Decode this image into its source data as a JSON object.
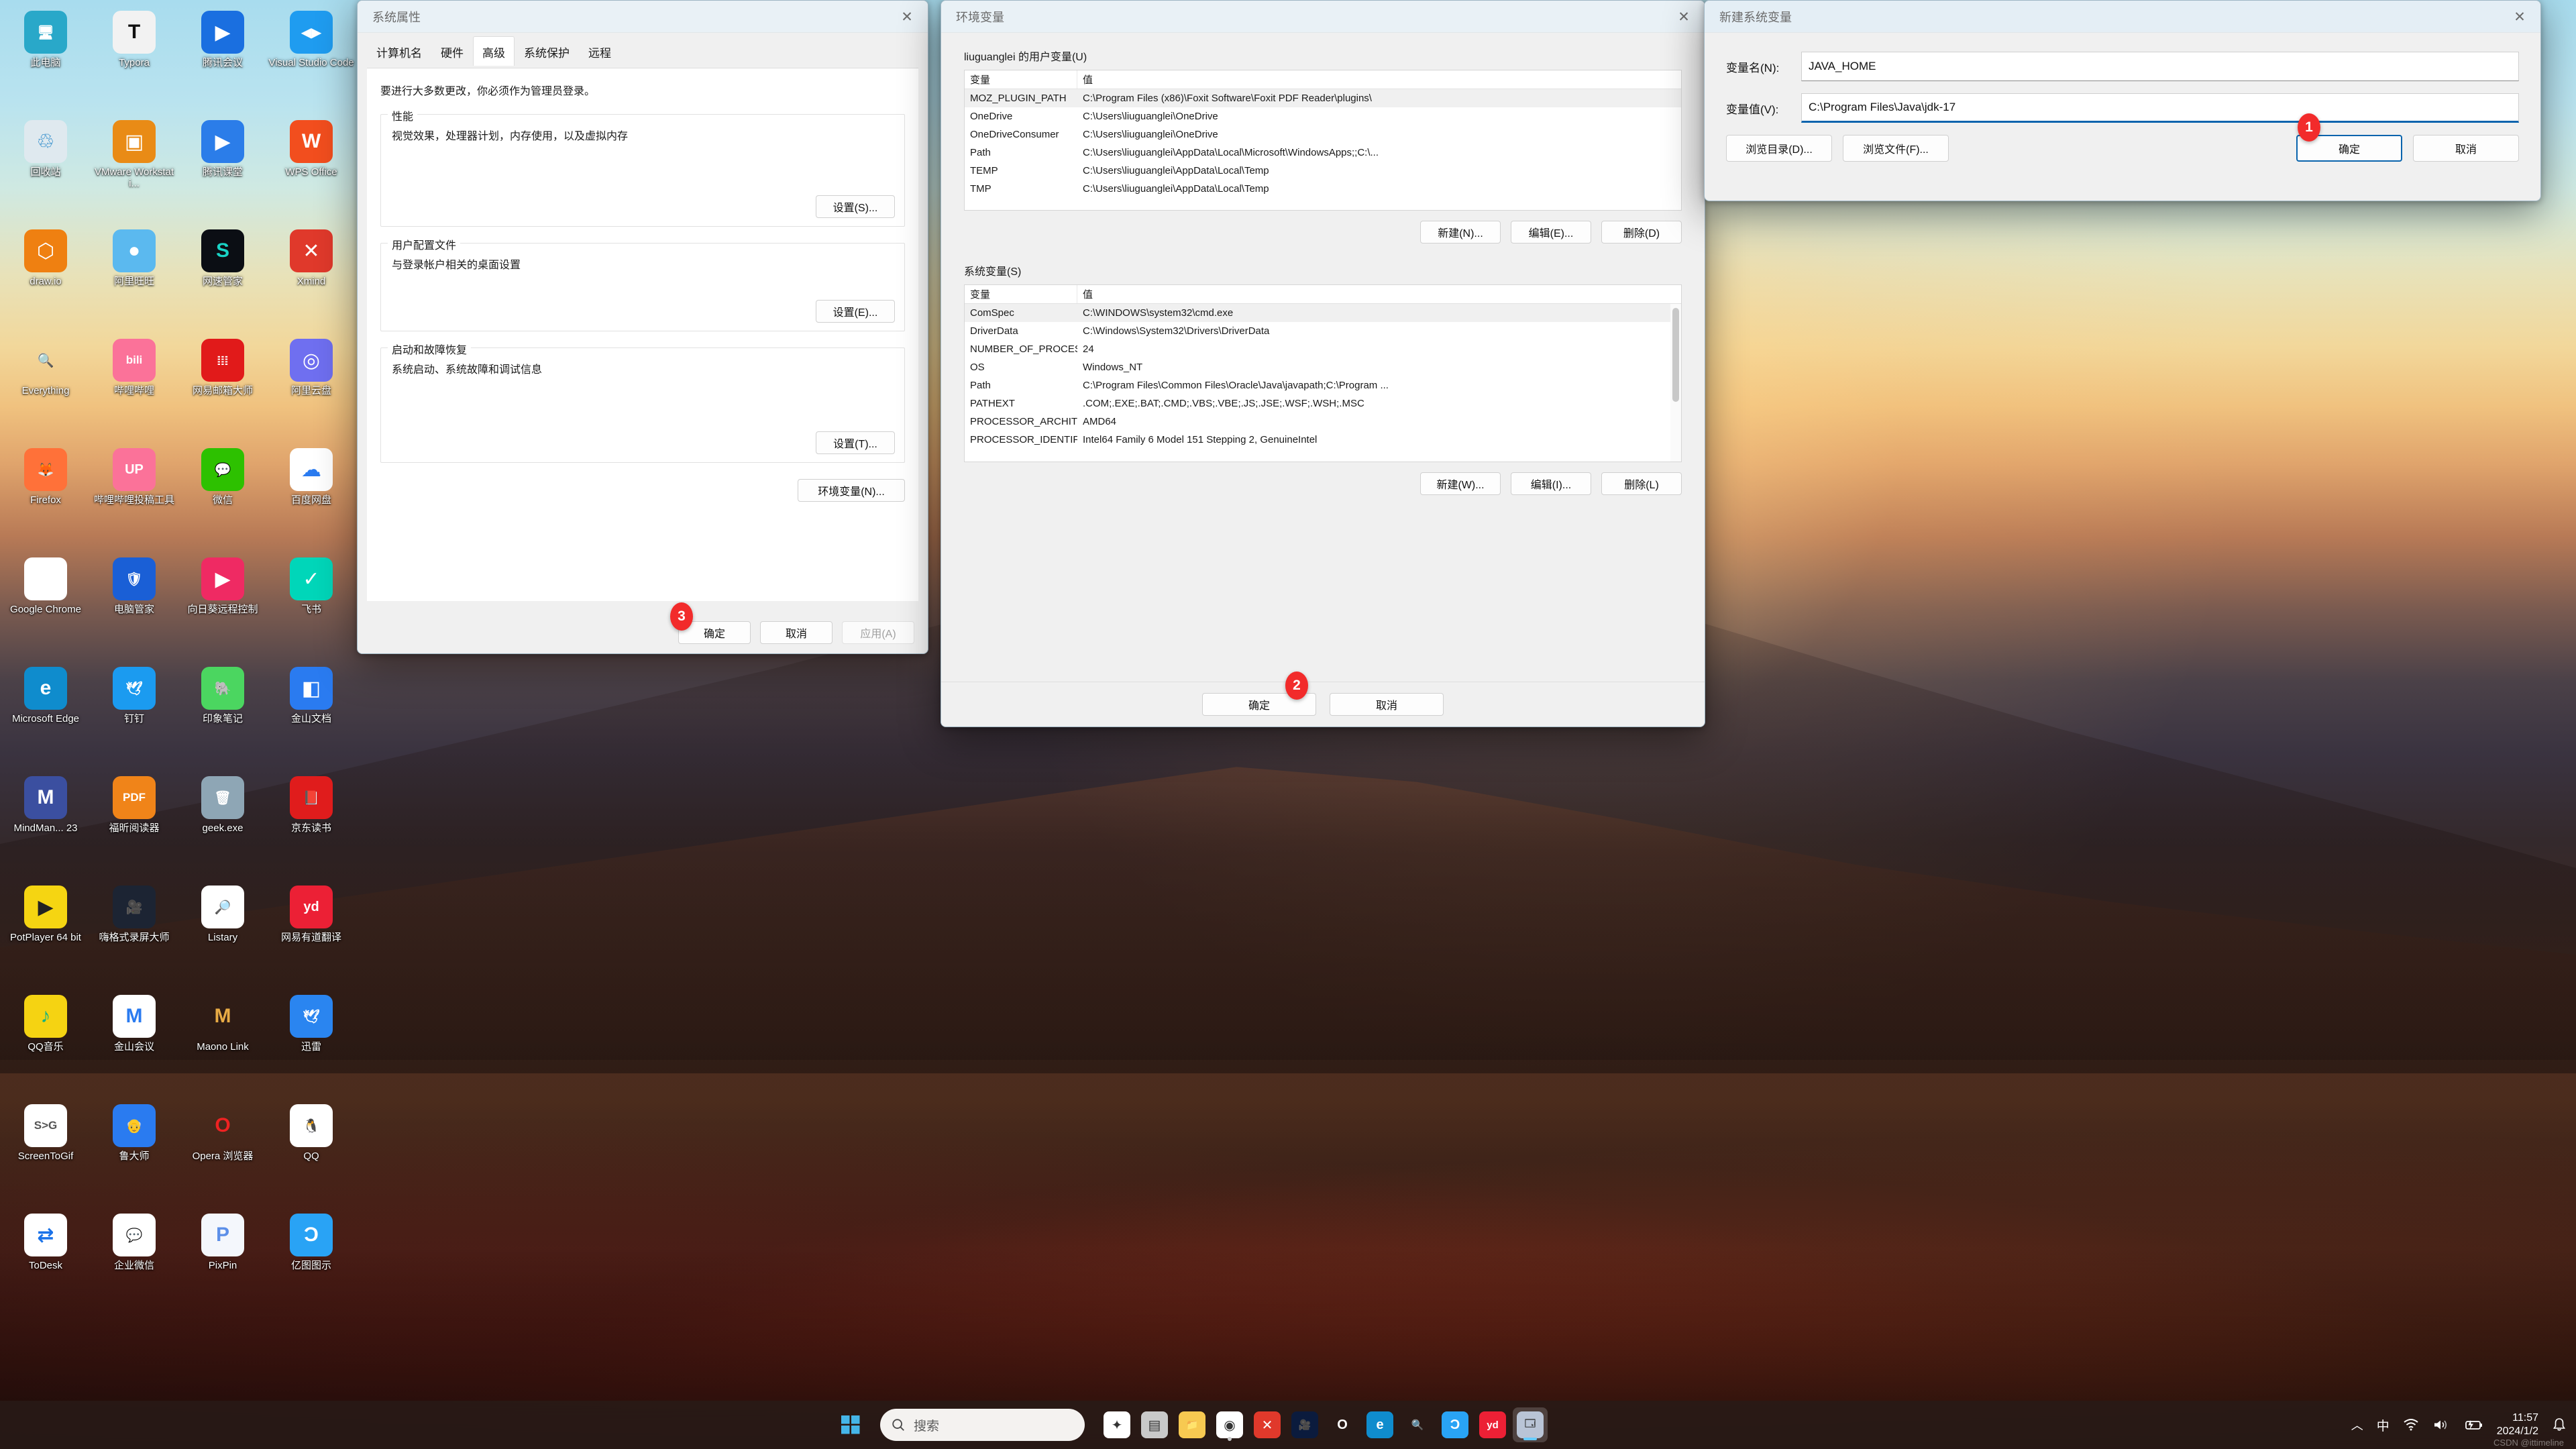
{
  "desktop": {
    "icons": [
      {
        "label": "此电脑",
        "icon": "this-pc-icon",
        "color": "#29a8c9",
        "glyph": "🖥"
      },
      {
        "label": "Typora",
        "icon": "typora-icon",
        "color": "#f2f2f2",
        "glyph": "T",
        "fg": "#111"
      },
      {
        "label": "腾讯会议",
        "icon": "tencent-meeting-icon",
        "color": "#1a6fe0",
        "glyph": "▶"
      },
      {
        "label": "Visual Studio Code",
        "icon": "vscode-icon",
        "color": "#1f9cf0",
        "glyph": "◀▶"
      },
      {
        "label": "回收站",
        "icon": "recycle-bin-icon",
        "color": "#dfe9ef",
        "glyph": "♲",
        "fg": "#1f84c8"
      },
      {
        "label": "VMware Workstati...",
        "icon": "vmware-icon",
        "color": "#e98b16",
        "glyph": "▣"
      },
      {
        "label": "腾讯课堂",
        "icon": "tencent-classroom-icon",
        "color": "#2b7de9",
        "glyph": "▶"
      },
      {
        "label": "WPS Office",
        "icon": "wps-office-icon",
        "color": "#f24e1e",
        "glyph": "W"
      },
      {
        "label": "draw.io",
        "icon": "drawio-icon",
        "color": "#ef8011",
        "glyph": "⬡"
      },
      {
        "label": "阿里旺旺",
        "icon": "aliwangwang-icon",
        "color": "#5bb9ef",
        "glyph": "●"
      },
      {
        "label": "网速管家",
        "icon": "netspeed-icon",
        "color": "#0b0e14",
        "glyph": "S",
        "fg": "#19d3c5"
      },
      {
        "label": "Xmind",
        "icon": "xmind-icon",
        "color": "#e0392b",
        "glyph": "✕"
      },
      {
        "label": "Everything",
        "icon": "everything-icon",
        "color": "#00000000",
        "glyph": "🔍",
        "fg": "#ef7f11"
      },
      {
        "label": "哔哩哔哩",
        "icon": "bilibili-icon",
        "color": "#fb7299",
        "glyph": "bili"
      },
      {
        "label": "网易邮箱大师",
        "icon": "netease-mail-icon",
        "color": "#e11a1a",
        "glyph": "𝍖"
      },
      {
        "label": "阿里云盘",
        "icon": "aliyun-drive-icon",
        "color": "#6f6ff0",
        "glyph": "◎"
      },
      {
        "label": "Firefox",
        "icon": "firefox-icon",
        "color": "#ff7139",
        "glyph": "🦊"
      },
      {
        "label": "哔哩哔哩投稿工具",
        "icon": "bilibili-upload-icon",
        "color": "#fb7299",
        "glyph": "UP"
      },
      {
        "label": "微信",
        "icon": "wechat-icon",
        "color": "#2dc100",
        "glyph": "💬"
      },
      {
        "label": "百度网盘",
        "icon": "baidu-netdisk-icon",
        "color": "#ffffff",
        "glyph": "☁",
        "fg": "#2a7bf0"
      },
      {
        "label": "Google Chrome",
        "icon": "chrome-icon",
        "color": "#ffffff",
        "glyph": "◉"
      },
      {
        "label": "电脑管家",
        "icon": "pc-manager-icon",
        "color": "#1a5fd6",
        "glyph": "🛡"
      },
      {
        "label": "向日葵远程控制",
        "icon": "sunlogin-icon",
        "color": "#ef2a63",
        "glyph": "▶"
      },
      {
        "label": "飞书",
        "icon": "feishu-icon",
        "color": "#00d6b9",
        "glyph": "✓"
      },
      {
        "label": "Microsoft Edge",
        "icon": "edge-icon",
        "color": "#0f8ccd",
        "glyph": "e"
      },
      {
        "label": "钉钉",
        "icon": "dingtalk-icon",
        "color": "#1b9bf0",
        "glyph": "🕊"
      },
      {
        "label": "印象笔记",
        "icon": "evernote-icon",
        "color": "#4bd660",
        "glyph": "🐘"
      },
      {
        "label": "金山文档",
        "icon": "kingsoft-docs-icon",
        "color": "#2a7bf0",
        "glyph": "◧"
      },
      {
        "label": "MindMan... 23",
        "icon": "mindmanager-icon",
        "color": "#3b4fa0",
        "glyph": "M"
      },
      {
        "label": "福昕阅读器",
        "icon": "foxit-reader-icon",
        "color": "#f08419",
        "glyph": "PDF"
      },
      {
        "label": "geek.exe",
        "icon": "geek-uninstaller-icon",
        "color": "#8ea6b5",
        "glyph": "🗑"
      },
      {
        "label": "京东读书",
        "icon": "jd-read-icon",
        "color": "#e01c1c",
        "glyph": "📕"
      },
      {
        "label": "PotPlayer 64 bit",
        "icon": "potplayer-icon",
        "color": "#f5d512",
        "glyph": "▶",
        "fg": "#222"
      },
      {
        "label": "嗨格式录屏大师",
        "icon": "higeshi-recorder-icon",
        "color": "#1c2433",
        "glyph": "🎥"
      },
      {
        "label": "Listary",
        "icon": "listary-icon",
        "color": "#ffffff",
        "glyph": "🔎"
      },
      {
        "label": "网易有道翻译",
        "icon": "youdao-translate-icon",
        "color": "#ec2035",
        "glyph": "yd"
      },
      {
        "label": "QQ音乐",
        "icon": "qq-music-icon",
        "color": "#f5d312",
        "glyph": "♪",
        "fg": "#16b37f"
      },
      {
        "label": "金山会议",
        "icon": "kingsoft-meeting-icon",
        "color": "#ffffff",
        "glyph": "M",
        "fg": "#2a7bf0"
      },
      {
        "label": "Maono Link",
        "icon": "maono-link-icon",
        "color": "#00000000",
        "glyph": "M",
        "fg": "#e8ab45"
      },
      {
        "label": "迅雷",
        "icon": "thunder-icon",
        "color": "#2a85f0",
        "glyph": "🕊"
      },
      {
        "label": "ScreenToGif",
        "icon": "screentogif-icon",
        "color": "#ffffff",
        "glyph": "S>G",
        "fg": "#555"
      },
      {
        "label": "鲁大师",
        "icon": "ludashi-icon",
        "color": "#2a7bf0",
        "glyph": "👴"
      },
      {
        "label": "Opera 浏览器",
        "icon": "opera-icon",
        "color": "#00000000",
        "glyph": "O",
        "fg": "#e22"
      },
      {
        "label": "QQ",
        "icon": "qq-icon",
        "color": "#ffffff",
        "glyph": "🐧"
      },
      {
        "label": "ToDesk",
        "icon": "todesk-icon",
        "color": "#ffffff",
        "glyph": "⇄",
        "fg": "#1a72e8"
      },
      {
        "label": "企业微信",
        "icon": "wecom-icon",
        "color": "#ffffff",
        "glyph": "💬",
        "fg": "#2a9bf0"
      },
      {
        "label": "PixPin",
        "icon": "pixpin-icon",
        "color": "#f4f7fc",
        "glyph": "P",
        "fg": "#5c8fe8"
      },
      {
        "label": "亿图图示",
        "icon": "edraw-icon",
        "color": "#29a3f5",
        "glyph": "Ɔ"
      }
    ]
  },
  "system_properties": {
    "title": "系统属性",
    "close_label": "✕",
    "tabs": [
      {
        "label": "计算机名",
        "selected": false
      },
      {
        "label": "硬件",
        "selected": false
      },
      {
        "label": "高级",
        "selected": true
      },
      {
        "label": "系统保护",
        "selected": false
      },
      {
        "label": "远程",
        "selected": false
      }
    ],
    "admin_note": "要进行大多数更改，你必须作为管理员登录。",
    "groups": [
      {
        "legend": "性能",
        "desc": "视觉效果，处理器计划，内存使用，以及虚拟内存",
        "button": "设置(S)..."
      },
      {
        "legend": "用户配置文件",
        "desc": "与登录帐户相关的桌面设置",
        "button": "设置(E)..."
      },
      {
        "legend": "启动和故障恢复",
        "desc": "系统启动、系统故障和调试信息",
        "button": "设置(T)..."
      }
    ],
    "env_button": "环境变量(N)...",
    "footer": {
      "ok": "确定",
      "cancel": "取消",
      "apply": "应用(A)"
    },
    "step_badge": "3"
  },
  "env_vars": {
    "title": "环境变量",
    "close_label": "✕",
    "user_section_label": "liuguanglei 的用户变量(U)",
    "system_section_label": "系统变量(S)",
    "columns": {
      "variable": "变量",
      "value": "值"
    },
    "user_rows": [
      {
        "variable": "MOZ_PLUGIN_PATH",
        "value": "C:\\Program Files (x86)\\Foxit Software\\Foxit PDF Reader\\plugins\\"
      },
      {
        "variable": "OneDrive",
        "value": "C:\\Users\\liuguanglei\\OneDrive"
      },
      {
        "variable": "OneDriveConsumer",
        "value": "C:\\Users\\liuguanglei\\OneDrive"
      },
      {
        "variable": "Path",
        "value": "C:\\Users\\liuguanglei\\AppData\\Local\\Microsoft\\WindowsApps;;C:\\..."
      },
      {
        "variable": "TEMP",
        "value": "C:\\Users\\liuguanglei\\AppData\\Local\\Temp"
      },
      {
        "variable": "TMP",
        "value": "C:\\Users\\liuguanglei\\AppData\\Local\\Temp"
      }
    ],
    "system_rows": [
      {
        "variable": "ComSpec",
        "value": "C:\\WINDOWS\\system32\\cmd.exe"
      },
      {
        "variable": "DriverData",
        "value": "C:\\Windows\\System32\\Drivers\\DriverData"
      },
      {
        "variable": "NUMBER_OF_PROCESSORS",
        "value": "24"
      },
      {
        "variable": "OS",
        "value": "Windows_NT"
      },
      {
        "variable": "Path",
        "value": "C:\\Program Files\\Common Files\\Oracle\\Java\\javapath;C:\\Program ..."
      },
      {
        "variable": "PATHEXT",
        "value": ".COM;.EXE;.BAT;.CMD;.VBS;.VBE;.JS;.JSE;.WSF;.WSH;.MSC"
      },
      {
        "variable": "PROCESSOR_ARCHITECTURE",
        "value": "AMD64"
      },
      {
        "variable": "PROCESSOR_IDENTIFIER",
        "value": "Intel64 Family 6 Model 151 Stepping 2, GenuineIntel"
      }
    ],
    "user_buttons": {
      "new": "新建(N)...",
      "edit": "编辑(E)...",
      "delete": "删除(D)"
    },
    "system_buttons": {
      "new": "新建(W)...",
      "edit": "编辑(I)...",
      "delete": "删除(L)"
    },
    "footer": {
      "ok": "确定",
      "cancel": "取消"
    },
    "step_badge": "2"
  },
  "new_system_var": {
    "title": "新建系统变量",
    "close_label": "✕",
    "name_label": "变量名(N):",
    "name_value": "JAVA_HOME",
    "value_label": "变量值(V):",
    "value_value": "C:\\Program Files\\Java\\jdk-17",
    "browse_dir": "浏览目录(D)...",
    "browse_file": "浏览文件(F)...",
    "ok": "确定",
    "cancel": "取消",
    "step_badge": "1",
    "accent": "#0a64ad"
  },
  "taskbar": {
    "start_label": "start-icon",
    "search_placeholder": "搜索",
    "items": [
      {
        "name": "copilot-icon",
        "color": "#ffffff",
        "glyph": "✦"
      },
      {
        "name": "task-view-icon",
        "color": "#c9c9c9",
        "glyph": "▤"
      },
      {
        "name": "file-explorer-icon",
        "color": "#f7c951",
        "glyph": "📁"
      },
      {
        "name": "chrome-icon",
        "color": "#ffffff",
        "glyph": "◉",
        "running": true
      },
      {
        "name": "xmind-icon",
        "color": "#e0392b",
        "glyph": "✕"
      },
      {
        "name": "tencent-meeting-icon",
        "color": "#0b1b3d",
        "glyph": "🎥"
      },
      {
        "name": "opera-icon",
        "color": "#00000000",
        "glyph": "O"
      },
      {
        "name": "edge-icon",
        "color": "#0f8ccd",
        "glyph": "e"
      },
      {
        "name": "everything-icon",
        "color": "#00000000",
        "glyph": "🔍"
      },
      {
        "name": "edraw-icon",
        "color": "#29a3f5",
        "glyph": "Ɔ"
      },
      {
        "name": "youdao-translate-icon",
        "color": "#ec2035",
        "glyph": "yd"
      },
      {
        "name": "system-properties-icon",
        "color": "#b9c4d6",
        "glyph": "🗔",
        "active": true
      }
    ],
    "tray": {
      "chevron": "︿",
      "ime": "中",
      "wifi": "wifi-icon",
      "volume": "volume-icon",
      "battery": "battery-icon",
      "time": "11:57",
      "date": "2024/1/2",
      "bell": "notification-bell-icon"
    },
    "watermark": "CSDN @ittimeline"
  }
}
